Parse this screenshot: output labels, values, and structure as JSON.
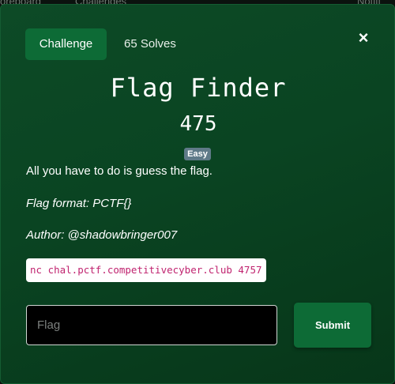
{
  "background_page": {
    "left_text": "oreboard",
    "mid_text": "Challenges",
    "right_text": "Notifi"
  },
  "modal": {
    "tabs": {
      "challenge_label": "Challenge",
      "solves_label": "65 Solves"
    },
    "close_symbol": "×",
    "challenge": {
      "name": "Flag Finder",
      "value": "475",
      "difficulty": "Easy",
      "description": "All you have to do is guess the flag.",
      "flag_format": "Flag format: PCTF{}",
      "author": "Author: @shadowbringer007",
      "connection": "nc chal.pctf.competitivecyber.club 4757"
    },
    "flag_input": {
      "value": "",
      "placeholder": "Flag"
    },
    "submit_label": "Submit"
  },
  "colors": {
    "modal_bg": "#0a4422",
    "accent_button": "#0d6b36",
    "badge": "#5f7a88",
    "code_text": "#c0236f"
  }
}
